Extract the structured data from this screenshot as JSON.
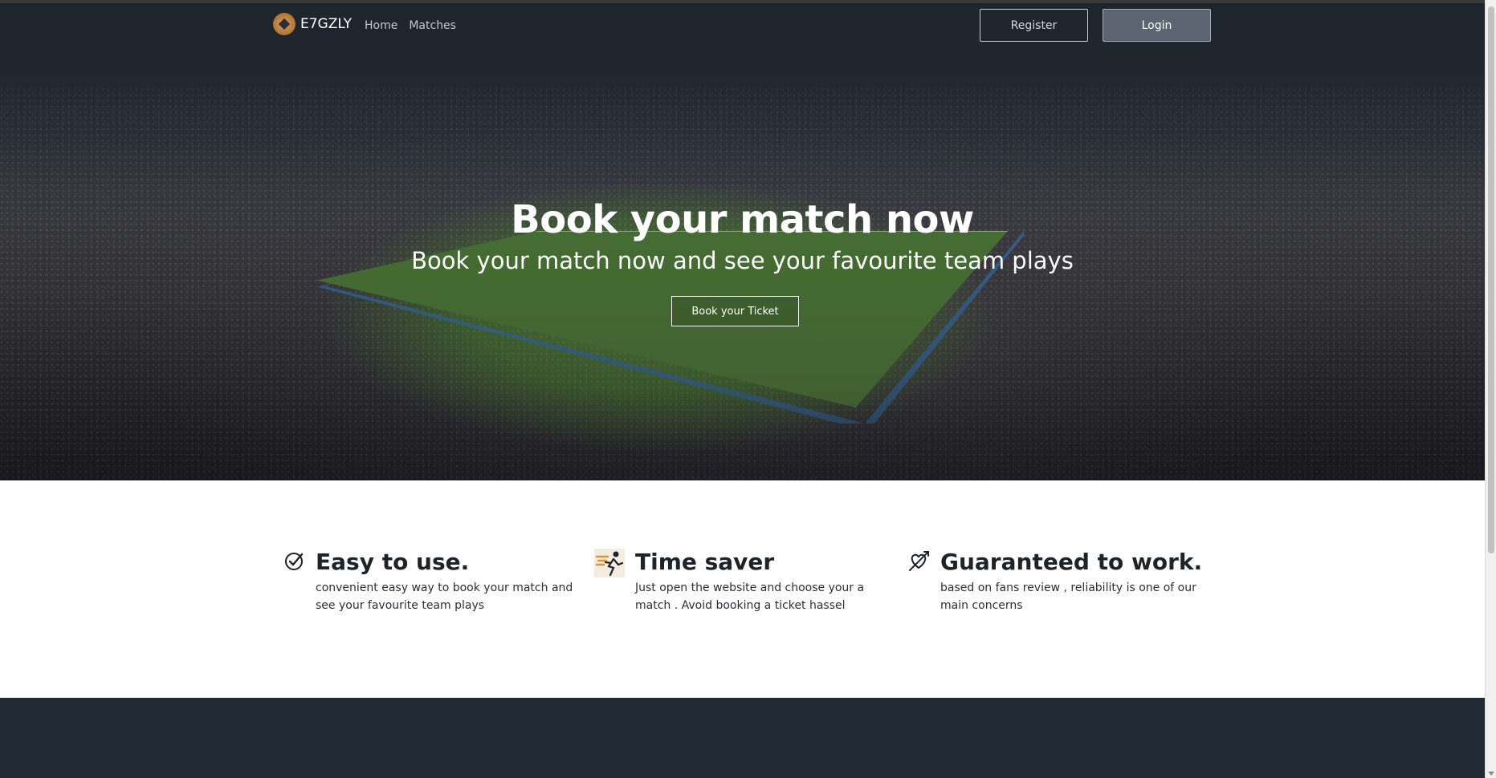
{
  "navbar": {
    "brand_name": "E7GZLY",
    "links": [
      "Home",
      "Matches"
    ],
    "register_label": "Register",
    "login_label": "Login"
  },
  "hero": {
    "title": "Book your match now",
    "subtitle": "Book your match now and see your favourite team plays",
    "cta_label": "Book your Ticket"
  },
  "features": [
    {
      "icon": "check-circle-icon",
      "title": "Easy to use.",
      "description": "convenient easy way to book your match and see your favourite team plays"
    },
    {
      "icon": "running-man-icon",
      "title": "Time saver",
      "description": "Just open the website and choose your a match . Avoid booking a ticket hassel"
    },
    {
      "icon": "heart-arrow-icon",
      "title": "Guaranteed to work.",
      "description": "based on fans review , reliability is one of our main concerns"
    }
  ],
  "colors": {
    "dark_bg": "#222a33",
    "login_bg": "#5b6470",
    "text_dark": "#1e2328"
  }
}
